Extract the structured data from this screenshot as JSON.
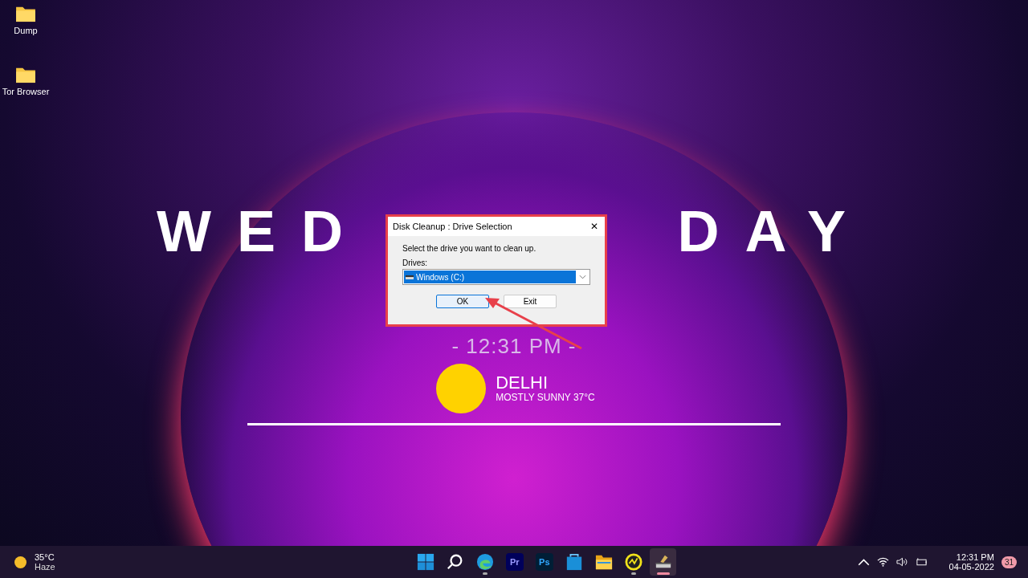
{
  "desktop_icons": [
    {
      "label": "Dump"
    },
    {
      "label": "Tor Browser"
    }
  ],
  "wallpaper": {
    "day_start": "WED",
    "day_end": "DAY",
    "time": "- 12:31 PM -",
    "city": "DELHI",
    "forecast": "MOSTLY SUNNY 37°C"
  },
  "dialog": {
    "title": "Disk Cleanup : Drive Selection",
    "close": "✕",
    "prompt": "Select the drive you want to clean up.",
    "drives_label": "Drives:",
    "drive": "Windows (C:)",
    "buttons": [
      {
        "label": "OK",
        "kind": "default"
      },
      {
        "label": "Exit",
        "kind": "normal"
      }
    ]
  },
  "taskbar": {
    "weather": {
      "temp": "35°C",
      "condition": "Haze"
    },
    "apps": [
      {
        "kind": "start",
        "running": false,
        "selected": false
      },
      {
        "kind": "search",
        "running": false,
        "selected": false
      },
      {
        "kind": "browser",
        "running": true,
        "selected": false
      },
      {
        "kind": "pr",
        "label": "Pr",
        "running": false,
        "selected": false
      },
      {
        "kind": "ps",
        "label": "Ps",
        "running": false,
        "selected": false
      },
      {
        "kind": "store",
        "running": false,
        "selected": false
      },
      {
        "kind": "folder",
        "running": false,
        "selected": false
      },
      {
        "kind": "chart",
        "running": true,
        "selected": false
      },
      {
        "kind": "cleanup",
        "running": true,
        "selected": true
      }
    ],
    "time": "12:31 PM",
    "date": "04-05-2022",
    "notifications": "31"
  }
}
